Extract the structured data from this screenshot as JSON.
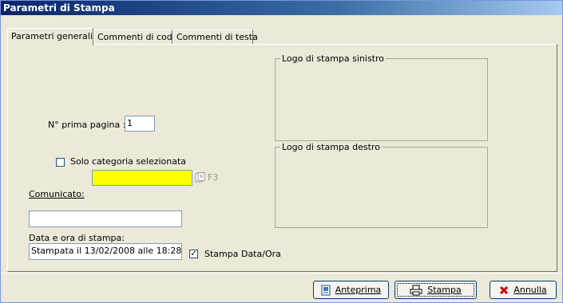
{
  "window": {
    "title": "Parametri di Stampa"
  },
  "tabs": [
    {
      "label": "Parametri generali"
    },
    {
      "label": "Commenti di coda"
    },
    {
      "label": "Commenti di testa"
    }
  ],
  "form": {
    "first_page_label": "N° prima pagina :",
    "first_page_value": "1",
    "only_selected_category_label": "Solo categoria selezionata",
    "only_selected_category_checked": false,
    "category_value": "",
    "category_lookup_hint": "F3",
    "communique_label": "Comunicato:",
    "communique_value": "",
    "print_datetime_label": "Data e ora di stampa:",
    "print_datetime_value": "Stampata il 13/02/2008 alle 18:28",
    "print_datetime_checkbox_label": "Stampa Data/Ora",
    "print_datetime_checked": true
  },
  "logos": {
    "left_label": "Logo di stampa sinistro",
    "right_label": "Logo di stampa destro"
  },
  "buttons": {
    "preview": "Anteprima",
    "print": "Stampa",
    "cancel": "Annulla"
  },
  "colors": {
    "highlight_field": "#ffff00",
    "title_bar": "#0a246a",
    "cancel_icon": "#d00000"
  }
}
